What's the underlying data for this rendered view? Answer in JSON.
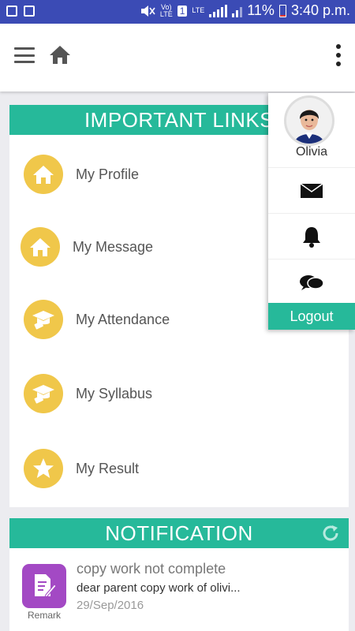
{
  "status_bar": {
    "volte_label": "Vo)\nLTE",
    "sim_label": "1",
    "lte_label": "LTE",
    "battery_text": "11%",
    "time": "3:40 p.m."
  },
  "header": {
    "menu_icon": "hamburger-icon",
    "home_icon": "home-icon",
    "overflow_icon": "more-vert-icon"
  },
  "important_links": {
    "title": "IMPORTANT LINKS",
    "items": [
      {
        "label": "My Profile",
        "icon": "home-icon"
      },
      {
        "label": "My Message",
        "icon": "home-icon"
      },
      {
        "label": "My Attendance",
        "icon": "graduation-cap-icon"
      },
      {
        "label": "My Syllabus",
        "icon": "graduation-cap-icon"
      },
      {
        "label": "My Result",
        "icon": "star-icon"
      }
    ]
  },
  "notification": {
    "title": "NOTIFICATION",
    "refresh_icon": "refresh-icon",
    "item": {
      "icon_label": "Remark",
      "title": "copy work not complete",
      "body": "dear parent copy work of olivi...",
      "date": "29/Sep/2016"
    }
  },
  "profile_menu": {
    "name": "Olivia",
    "items": [
      "mail-icon",
      "bell-icon",
      "chat-icon"
    ],
    "logout_label": "Logout"
  },
  "colors": {
    "status_bar": "#3b4bb5",
    "accent": "#26b99a",
    "link_circle": "#f0c74a",
    "remark_icon": "#a349c4"
  }
}
